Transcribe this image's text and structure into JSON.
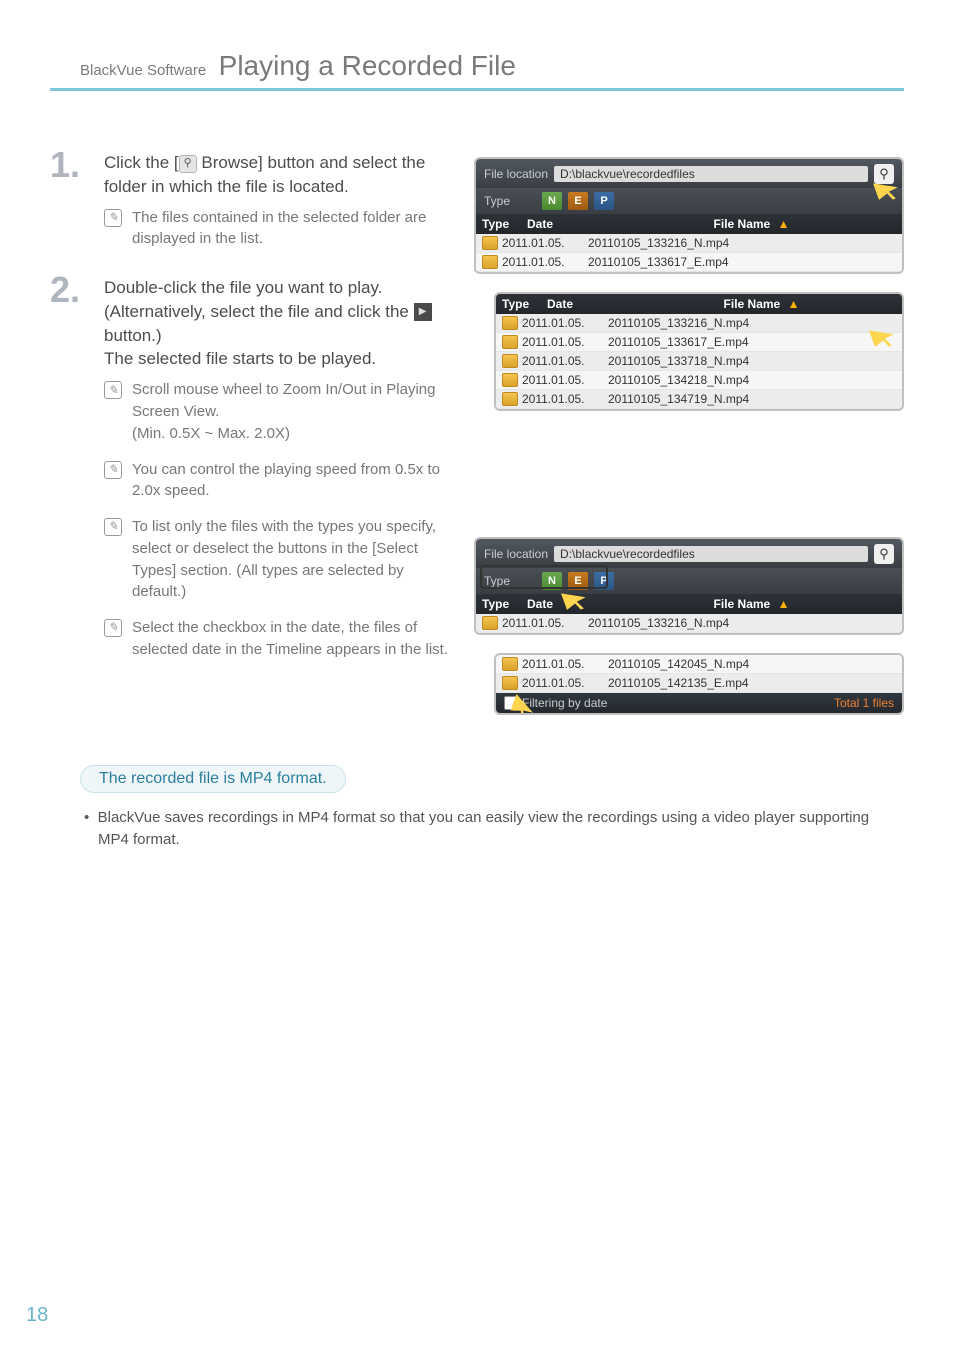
{
  "header": {
    "prefix": "BlackVue Software",
    "title": "Playing a Recorded File"
  },
  "steps": [
    {
      "num": "1.",
      "body_pre": "Click the [",
      "body_post": " Browse] button and select the folder in which the file is located.",
      "notes": [
        {
          "text": "The files contained in the selected folder are displayed in the list."
        }
      ]
    },
    {
      "num": "2.",
      "body_line1_pre": "Double-click the file you want to play. (Alternatively, select the file and click the ",
      "body_line1_post": " button.)",
      "body_line2": "The selected file starts to be played.",
      "notes": [
        {
          "text": "Scroll mouse wheel to Zoom In/Out in Playing Screen View.",
          "sub": "(Min. 0.5X ~ Max. 2.0X)"
        },
        {
          "text": "You can control the playing speed from 0.5x to 2.0x speed."
        },
        {
          "text": "To list only the files with the types you specify, select or deselect the buttons in the [Select Types] section. (All types are selected by default.)"
        },
        {
          "text": "Select the checkbox in the date, the files of selected date in the Timeline appears in the list."
        }
      ]
    }
  ],
  "screenshots": {
    "s1": {
      "file_loc_label": "File location",
      "file_loc_value": "D:\\blackvue\\recordedfiles",
      "type_label": "Type",
      "type_buttons": [
        "N",
        "E",
        "P"
      ],
      "col_type": "Type",
      "col_date": "Date",
      "col_file": "File Name",
      "rows": [
        {
          "date": "2011.01.05.",
          "file": "20110105_133216_N.mp4"
        },
        {
          "date": "2011.01.05.",
          "file": "20110105_133617_E.mp4"
        }
      ]
    },
    "s2": {
      "col_type": "Type",
      "col_date": "Date",
      "col_file": "File Name",
      "rows": [
        {
          "date": "2011.01.05.",
          "file": "20110105_133216_N.mp4"
        },
        {
          "date": "2011.01.05.",
          "file": "20110105_133617_E.mp4"
        },
        {
          "date": "2011.01.05.",
          "file": "20110105_133718_N.mp4"
        },
        {
          "date": "2011.01.05.",
          "file": "20110105_134218_N.mp4"
        },
        {
          "date": "2011.01.05.",
          "file": "20110105_134719_N.mp4"
        }
      ]
    },
    "s3": {
      "file_loc_label": "File location",
      "file_loc_value": "D:\\blackvue\\recordedfiles",
      "type_label": "Type",
      "type_buttons": [
        "N",
        "E",
        "P"
      ],
      "col_type": "Type",
      "col_date": "Date",
      "col_file": "File Name",
      "rows": [
        {
          "date": "2011.01.05.",
          "file": "20110105_133216_N.mp4"
        }
      ]
    },
    "s4": {
      "rows": [
        {
          "date": "2011.01.05.",
          "file": "20110105_142045_N.mp4"
        },
        {
          "date": "2011.01.05.",
          "file": "20110105_142135_E.mp4"
        }
      ],
      "filter_label": "Filtering by date",
      "total_label": "Total 1 files"
    }
  },
  "callout": "The recorded file is MP4 format.",
  "bullet": "BlackVue saves recordings in MP4 format so that you can easily view the recordings using a video player supporting MP4 format.",
  "page_number": "18",
  "sort_triangle": "▲",
  "search_glyph": "⚲",
  "play_glyph": "▶",
  "bullet_glyph": "•"
}
